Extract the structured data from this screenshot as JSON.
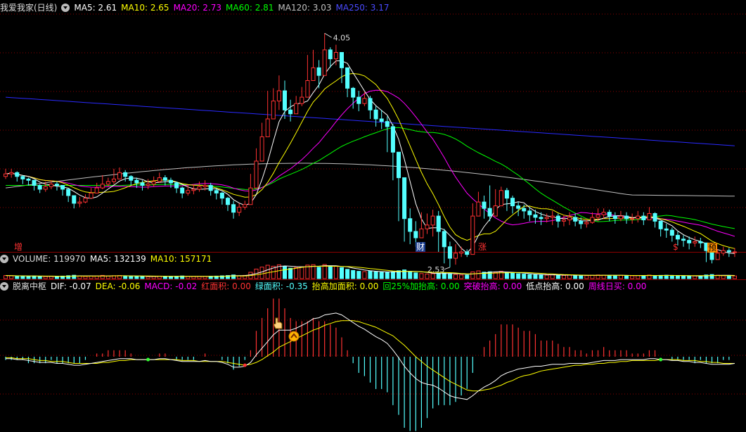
{
  "colors": {
    "up": "#ff3232",
    "down": "#54ffff",
    "ma5": "#ffffff",
    "ma10": "#ffff00",
    "ma20": "#ff00ff",
    "ma60": "#00ff00",
    "ma120": "#c0c0c0",
    "ma250": "#2a2aff",
    "dif": "#ffffff",
    "dea": "#ffff00",
    "grid": "#8b0000"
  },
  "icons": [
    "panel-collapse-icon",
    "hand-pointer-icon",
    "up-arrow-badge-icon"
  ],
  "price_panel": {
    "title": "我爱我家(日线)",
    "ma5": "MA5: 2.61",
    "ma10": "MA10: 2.65",
    "ma20": "MA20: 2.73",
    "ma60": "MA60: 2.81",
    "ma120": "MA120: 3.03",
    "ma250": "MA250: 3.17",
    "high_label": "4.05",
    "low_label": "2.53",
    "markers": [
      "增",
      "财",
      "涨",
      "$",
      "预"
    ]
  },
  "volume_panel": {
    "label": "VOLUME: 119970",
    "ma5": "MA5: 132139",
    "ma10": "MA10: 157171"
  },
  "indicator_panel": {
    "title": "脱离中枢",
    "dif": "DIF: -0.07",
    "dea": "DEA: -0.06",
    "macd": "MACD: -0.02",
    "red_area": "红面积: 0.00",
    "green_area": "绿面积: -0.35",
    "raise_area": "抬高加面积: 0.00",
    "pullback": "回25%加抬高: 0.00",
    "breakout": "突破抬高: 0.00",
    "low_raise": "低点抬高: 0.00",
    "weekly_buy": "周线日买: 0.00"
  },
  "chart_data": [
    {
      "type": "candlestick",
      "title": "我爱我家(日线)",
      "ylim": [
        2.45,
        4.2
      ],
      "close": [
        2.95,
        2.96,
        2.93,
        2.91,
        2.9,
        2.86,
        2.83,
        2.85,
        2.87,
        2.86,
        2.83,
        2.78,
        2.72,
        2.73,
        2.76,
        2.8,
        2.84,
        2.87,
        2.89,
        2.91,
        2.96,
        2.93,
        2.9,
        2.88,
        2.86,
        2.87,
        2.89,
        2.92,
        2.9,
        2.88,
        2.84,
        2.8,
        2.82,
        2.83,
        2.85,
        2.86,
        2.82,
        2.8,
        2.76,
        2.71,
        2.65,
        2.69,
        2.71,
        2.84,
        3.05,
        3.24,
        3.38,
        3.52,
        3.6,
        3.45,
        3.42,
        3.5,
        3.55,
        3.68,
        3.78,
        3.72,
        3.92,
        3.85,
        3.9,
        3.78,
        3.62,
        3.55,
        3.5,
        3.54,
        3.45,
        3.38,
        3.36,
        3.32,
        3.12,
        2.92,
        2.6,
        2.5,
        2.45,
        2.52,
        2.55,
        2.62,
        2.5,
        2.38,
        2.29,
        2.33,
        2.34,
        2.32,
        2.62,
        2.73,
        2.68,
        2.62,
        2.7,
        2.82,
        2.76,
        2.7,
        2.68,
        2.66,
        2.63,
        2.61,
        2.6,
        2.61,
        2.62,
        2.58,
        2.59,
        2.61,
        2.58,
        2.56,
        2.57,
        2.61,
        2.63,
        2.65,
        2.62,
        2.6,
        2.62,
        2.6,
        2.6,
        2.62,
        2.59,
        2.64,
        2.58,
        2.52,
        2.51,
        2.47,
        2.44,
        2.43,
        2.41,
        2.42,
        2.41,
        2.35,
        2.28,
        2.33,
        2.35,
        2.34,
        2.34
      ],
      "high": [
        2.99,
        2.99,
        2.97,
        2.94,
        2.92,
        2.9,
        2.87,
        2.89,
        2.9,
        2.89,
        2.86,
        2.83,
        2.77,
        2.77,
        2.79,
        2.84,
        2.88,
        2.94,
        2.92,
        2.99,
        3.0,
        2.98,
        2.94,
        2.92,
        2.9,
        2.91,
        2.93,
        2.96,
        2.94,
        2.92,
        2.89,
        2.85,
        2.86,
        2.87,
        2.89,
        2.9,
        2.88,
        2.84,
        2.81,
        2.77,
        2.74,
        2.72,
        2.74,
        2.95,
        3.15,
        3.35,
        3.6,
        3.62,
        3.72,
        3.68,
        3.53,
        3.56,
        3.63,
        3.88,
        3.92,
        3.84,
        4.05,
        3.94,
        3.96,
        3.9,
        3.75,
        3.63,
        3.6,
        3.59,
        3.56,
        3.48,
        3.45,
        3.4,
        3.34,
        3.12,
        2.92,
        2.68,
        2.58,
        2.65,
        2.64,
        2.67,
        2.66,
        2.52,
        2.42,
        2.4,
        2.38,
        2.36,
        2.72,
        2.81,
        2.78,
        2.86,
        2.83,
        2.85,
        2.84,
        2.78,
        2.73,
        2.71,
        2.69,
        2.67,
        2.65,
        2.64,
        2.66,
        2.64,
        2.63,
        2.65,
        2.64,
        2.61,
        2.6,
        2.65,
        2.68,
        2.68,
        2.67,
        2.65,
        2.66,
        2.65,
        2.64,
        2.66,
        2.65,
        2.69,
        2.65,
        2.58,
        2.56,
        2.53,
        2.5,
        2.47,
        2.46,
        2.46,
        2.45,
        2.41,
        2.35,
        2.36,
        2.38,
        2.37,
        2.37
      ],
      "low": [
        2.91,
        2.92,
        2.89,
        2.87,
        2.86,
        2.82,
        2.8,
        2.81,
        2.83,
        2.82,
        2.78,
        2.73,
        2.68,
        2.69,
        2.72,
        2.76,
        2.8,
        2.83,
        2.85,
        2.87,
        2.92,
        2.89,
        2.86,
        2.84,
        2.82,
        2.83,
        2.85,
        2.88,
        2.86,
        2.84,
        2.8,
        2.76,
        2.78,
        2.79,
        2.81,
        2.82,
        2.78,
        2.75,
        2.71,
        2.66,
        2.6,
        2.62,
        2.67,
        2.8,
        3.0,
        3.18,
        3.3,
        3.4,
        3.45,
        3.38,
        3.36,
        3.44,
        3.48,
        3.58,
        3.68,
        3.62,
        3.82,
        3.78,
        3.8,
        3.66,
        3.55,
        3.46,
        3.44,
        3.48,
        3.38,
        3.32,
        3.3,
        3.12,
        2.9,
        2.58,
        2.42,
        2.4,
        2.38,
        2.45,
        2.48,
        2.46,
        2.34,
        2.25,
        2.22,
        2.24,
        2.3,
        2.3,
        2.58,
        2.63,
        2.6,
        2.58,
        2.64,
        2.7,
        2.66,
        2.64,
        2.62,
        2.6,
        2.58,
        2.56,
        2.55,
        2.57,
        2.55,
        2.53,
        2.54,
        2.55,
        2.54,
        2.52,
        2.53,
        2.56,
        2.58,
        2.6,
        2.58,
        2.56,
        2.58,
        2.56,
        2.56,
        2.57,
        2.55,
        2.59,
        2.53,
        2.46,
        2.45,
        2.42,
        2.39,
        2.38,
        2.36,
        2.38,
        2.37,
        2.26,
        2.25,
        2.28,
        2.31,
        2.3,
        2.3
      ]
    },
    {
      "type": "bar",
      "title": "VOLUME",
      "values": [
        2.2,
        2.0,
        1.8,
        1.7,
        1.6,
        1.9,
        1.7,
        1.5,
        1.6,
        1.5,
        1.8,
        2.1,
        2.4,
        1.9,
        1.6,
        1.8,
        1.9,
        2.3,
        1.8,
        2.1,
        2.2,
        1.9,
        1.7,
        1.6,
        1.5,
        1.4,
        1.6,
        1.8,
        1.7,
        1.5,
        1.6,
        1.9,
        1.6,
        1.5,
        1.6,
        1.5,
        1.7,
        1.8,
        2.0,
        2.2,
        2.6,
        2.0,
        2.3,
        4.5,
        6.8,
        8.2,
        9.5,
        8.8,
        9.8,
        8.6,
        7.4,
        7.9,
        8.4,
        9.6,
        9.9,
        8.1,
        10.0,
        8.5,
        8.9,
        7.8,
        6.6,
        5.8,
        5.2,
        5.0,
        5.4,
        4.8,
        4.5,
        4.4,
        4.9,
        5.6,
        6.2,
        5.0,
        4.1,
        3.6,
        3.3,
        3.5,
        3.8,
        3.9,
        3.6,
        2.9,
        2.6,
        2.5,
        4.8,
        5.5,
        4.6,
        4.9,
        4.3,
        5.2,
        4.4,
        3.8,
        3.5,
        3.2,
        2.9,
        2.7,
        2.6,
        2.5,
        2.7,
        2.4,
        2.3,
        2.5,
        2.3,
        2.2,
        2.1,
        2.4,
        2.6,
        2.5,
        2.3,
        2.2,
        2.3,
        2.1,
        2.0,
        2.2,
        2.1,
        2.5,
        2.2,
        2.3,
        2.4,
        2.2,
        2.0,
        1.9,
        1.8,
        1.9,
        1.8,
        2.6,
        2.9,
        2.4,
        2.1,
        2.0,
        1.9
      ]
    },
    {
      "type": "line",
      "title": "脱离中枢",
      "series": [
        {
          "name": "DIF",
          "values": [
            -0.02,
            -0.02,
            -0.03,
            -0.03,
            -0.04,
            -0.05,
            -0.06,
            -0.06,
            -0.06,
            -0.07,
            -0.07,
            -0.08,
            -0.09,
            -0.09,
            -0.08,
            -0.07,
            -0.06,
            -0.05,
            -0.04,
            -0.03,
            -0.02,
            -0.02,
            -0.02,
            -0.03,
            -0.03,
            -0.03,
            -0.03,
            -0.02,
            -0.02,
            -0.03,
            -0.04,
            -0.05,
            -0.05,
            -0.05,
            -0.05,
            -0.04,
            -0.05,
            -0.05,
            -0.06,
            -0.08,
            -0.11,
            -0.11,
            -0.1,
            -0.06,
            0.02,
            0.09,
            0.16,
            0.23,
            0.28,
            0.28,
            0.28,
            0.3,
            0.33,
            0.36,
            0.4,
            0.41,
            0.44,
            0.45,
            0.46,
            0.44,
            0.4,
            0.36,
            0.32,
            0.29,
            0.25,
            0.21,
            0.18,
            0.14,
            0.07,
            -0.01,
            -0.1,
            -0.17,
            -0.23,
            -0.27,
            -0.29,
            -0.3,
            -0.33,
            -0.37,
            -0.41,
            -0.43,
            -0.44,
            -0.45,
            -0.41,
            -0.36,
            -0.32,
            -0.29,
            -0.25,
            -0.2,
            -0.17,
            -0.15,
            -0.13,
            -0.12,
            -0.11,
            -0.1,
            -0.1,
            -0.09,
            -0.08,
            -0.08,
            -0.08,
            -0.07,
            -0.07,
            -0.07,
            -0.07,
            -0.06,
            -0.05,
            -0.04,
            -0.04,
            -0.04,
            -0.03,
            -0.03,
            -0.03,
            -0.03,
            -0.03,
            -0.02,
            -0.02,
            -0.03,
            -0.03,
            -0.04,
            -0.04,
            -0.05,
            -0.05,
            -0.06,
            -0.06,
            -0.07,
            -0.08,
            -0.08,
            -0.08,
            -0.08,
            -0.07
          ]
        },
        {
          "name": "DEA",
          "values": [
            -0.01,
            -0.01,
            -0.02,
            -0.02,
            -0.02,
            -0.03,
            -0.04,
            -0.04,
            -0.05,
            -0.05,
            -0.05,
            -0.06,
            -0.07,
            -0.07,
            -0.07,
            -0.07,
            -0.07,
            -0.06,
            -0.06,
            -0.05,
            -0.04,
            -0.04,
            -0.03,
            -0.03,
            -0.03,
            -0.03,
            -0.03,
            -0.03,
            -0.03,
            -0.03,
            -0.03,
            -0.04,
            -0.04,
            -0.04,
            -0.05,
            -0.05,
            -0.05,
            -0.05,
            -0.05,
            -0.06,
            -0.07,
            -0.08,
            -0.09,
            -0.08,
            -0.06,
            -0.03,
            0.01,
            0.05,
            0.1,
            0.13,
            0.16,
            0.19,
            0.22,
            0.25,
            0.28,
            0.3,
            0.33,
            0.35,
            0.37,
            0.38,
            0.38,
            0.38,
            0.37,
            0.35,
            0.33,
            0.31,
            0.28,
            0.25,
            0.22,
            0.17,
            0.12,
            0.06,
            0.0,
            -0.05,
            -0.1,
            -0.14,
            -0.18,
            -0.22,
            -0.26,
            -0.29,
            -0.32,
            -0.35,
            -0.36,
            -0.36,
            -0.35,
            -0.34,
            -0.32,
            -0.3,
            -0.27,
            -0.25,
            -0.22,
            -0.2,
            -0.19,
            -0.17,
            -0.15,
            -0.14,
            -0.13,
            -0.12,
            -0.11,
            -0.1,
            -0.09,
            -0.09,
            -0.08,
            -0.08,
            -0.07,
            -0.07,
            -0.06,
            -0.06,
            -0.05,
            -0.05,
            -0.04,
            -0.04,
            -0.04,
            -0.04,
            -0.04,
            -0.03,
            -0.03,
            -0.03,
            -0.03,
            -0.04,
            -0.04,
            -0.04,
            -0.05,
            -0.05,
            -0.06,
            -0.06,
            -0.07,
            -0.07,
            -0.07
          ]
        }
      ]
    }
  ]
}
